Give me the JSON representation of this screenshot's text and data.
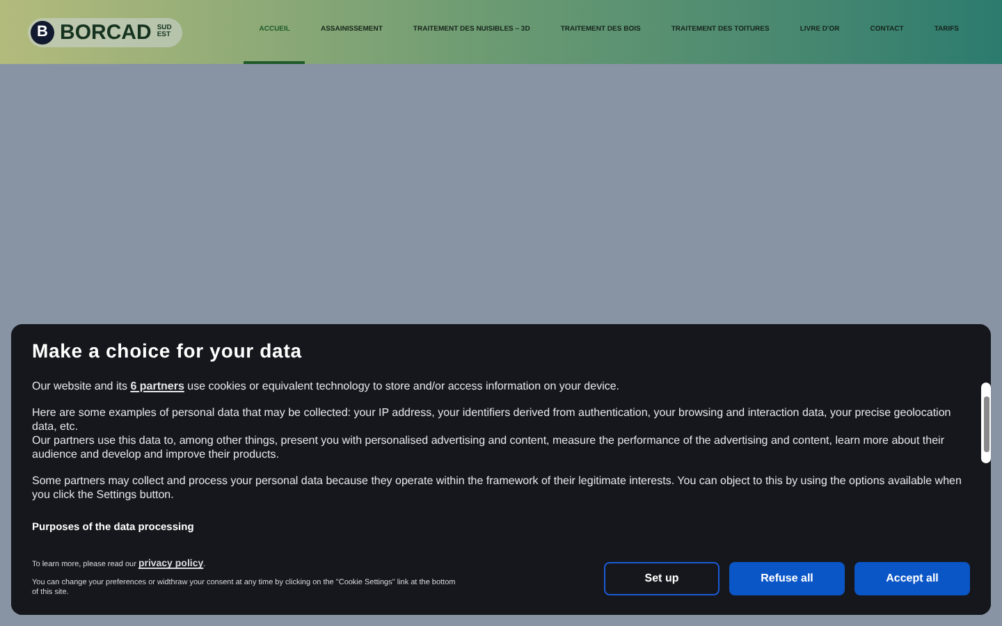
{
  "header": {
    "logo": {
      "letter": "B",
      "name": "BORCAD",
      "suffix_top": "SUD",
      "suffix_bottom": "EST"
    },
    "nav": [
      {
        "label": "ACCUEIL",
        "selected": true
      },
      {
        "label": "ASSAINISSEMENT",
        "selected": false
      },
      {
        "label": "TRAITEMENT DES NUISIBLES – 3D",
        "selected": false
      },
      {
        "label": "TRAITEMENT DES BOIS",
        "selected": false
      },
      {
        "label": "TRAITEMENT DES TOITURES",
        "selected": false
      },
      {
        "label": "LIVRE D'OR",
        "selected": false
      },
      {
        "label": "CONTACT",
        "selected": false
      },
      {
        "label": "TARIFS",
        "selected": false
      }
    ]
  },
  "consent": {
    "title": "Make a choice for your data",
    "paragraphs": [
      {
        "before": "Our website and its ",
        "link": "6 partners",
        "after": " use cookies or equivalent technology to store and/or access information on your device."
      },
      {
        "text": "Here are some examples of personal data that may be collected: your IP address, your identifiers derived from authentication, your browsing and interaction data, your precise geolocation data, etc."
      },
      {
        "text": "Our partners use this data to, among other things, present you with personalised advertising and content, measure the performance of the advertising and content, learn more about their audience and develop and improve their products."
      },
      {
        "text": "Some partners may collect and process your personal data because they operate within the framework of their legitimate interests. You can object to this by using the options available when you click the Settings button."
      }
    ],
    "section_title": "Purposes of the data processing",
    "learn_more": {
      "before": "To learn more, please read our ",
      "link": "privacy policy",
      "after": "."
    },
    "footer_note": "You can change your preferences or widthraw your consent at any time by clicking on the \"Cookie Settings\" link at the bottom of this site.",
    "buttons": [
      {
        "label": "Set up",
        "kind": "outline"
      },
      {
        "label": "Refuse all",
        "kind": "filled"
      },
      {
        "label": "Accept all",
        "kind": "filled"
      }
    ]
  }
}
